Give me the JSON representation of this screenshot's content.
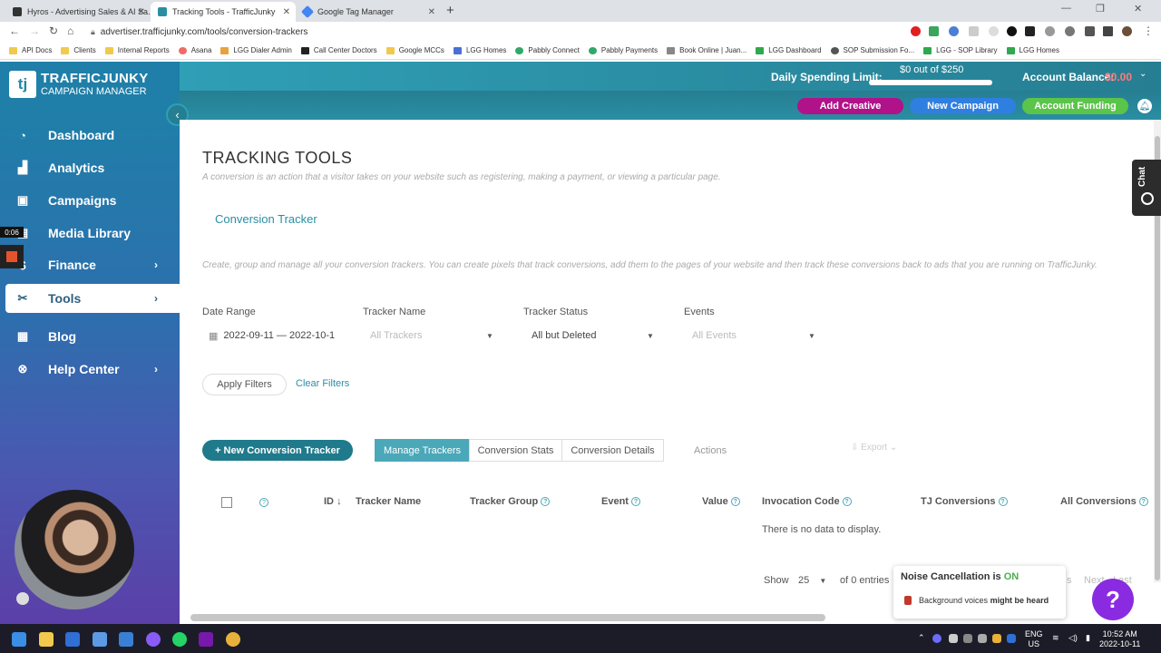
{
  "browser": {
    "tabs": [
      {
        "label": "Hyros - Advertising Sales & AI Sa...",
        "active": false
      },
      {
        "label": "Tracking Tools - TrafficJunky",
        "active": true
      },
      {
        "label": "Google Tag Manager",
        "active": false
      }
    ],
    "new_tab": "+",
    "url": "advertiser.trafficjunky.com/tools/conversion-trackers",
    "bookmarks": [
      "API Docs",
      "Clients",
      "Internal Reports",
      "Asana",
      "LGG Dialer Admin",
      "Call Center Doctors",
      "Google MCCs",
      "LGG Homes",
      "Pabbly Connect",
      "Pabbly Payments",
      "Book Online | Juan...",
      "LGG Dashboard",
      "SOP Submission Fo...",
      "LGG - SOP Library",
      "LGG Homes"
    ]
  },
  "app": {
    "logo_mark": "tj",
    "logo_line1": "TRAFFICJUNKY",
    "logo_line2": "CAMPAIGN MANAGER"
  },
  "header": {
    "spending_label": "Daily Spending Limit:",
    "spending_value": "$0 out of $250",
    "spending_progress": 0,
    "balance_label": "Account Balance:",
    "balance_value": "$0.00",
    "buttons": {
      "add_creative": "Add Creative",
      "new_campaign": "New Campaign",
      "account_funding": "Account Funding"
    },
    "colors": {
      "add_creative": "#b0128a",
      "new_campaign": "#2f7fe0",
      "account_funding": "#5bc44a"
    }
  },
  "sidebar": {
    "items": [
      {
        "label": "Dashboard",
        "icon": "dashboard-icon"
      },
      {
        "label": "Analytics",
        "icon": "analytics-icon"
      },
      {
        "label": "Campaigns",
        "icon": "campaigns-icon"
      },
      {
        "label": "Media Library",
        "icon": "media-icon"
      },
      {
        "label": "Finance",
        "icon": "finance-icon"
      },
      {
        "label": "Tools",
        "icon": "tools-icon"
      },
      {
        "label": "Blog",
        "icon": "blog-icon"
      },
      {
        "label": "Help Center",
        "icon": "help-icon"
      }
    ],
    "recording_time": "0:06"
  },
  "page": {
    "title": "TRACKING TOOLS",
    "description": "A conversion is an action that a visitor takes on your website such as registering, making a payment, or viewing a particular page.",
    "section_tab": "Conversion Tracker",
    "section_description": "Create, group and manage all your conversion trackers. You can create pixels that track conversions, add them to the pages of your website and then track these conversions back to ads that you are running on TrafficJunky."
  },
  "filters": {
    "date_range_label": "Date Range",
    "date_range_value": "2022-09-11 — 2022-10-1",
    "tracker_name_label": "Tracker Name",
    "tracker_name_placeholder": "All Trackers",
    "tracker_status_label": "Tracker Status",
    "tracker_status_value": "All but Deleted",
    "events_label": "Events",
    "events_placeholder": "All Events",
    "apply": "Apply Filters",
    "clear": "Clear Filters"
  },
  "toolbar": {
    "new_tracker": "+ New Conversion Tracker",
    "tabs": [
      "Manage Trackers",
      "Conversion Stats",
      "Conversion Details"
    ],
    "actions": "Actions",
    "export": "Export"
  },
  "table": {
    "columns": [
      "ID",
      "Tracker Name",
      "Tracker Group",
      "Event",
      "Value",
      "Invocation Code",
      "TJ Conversions",
      "All Conversions"
    ],
    "empty_message": "There is no data to display.",
    "show_label": "Show",
    "page_size": "25",
    "entries_text": "of 0 entries",
    "pagination_partial": "s",
    "next": "Next",
    "last": "Last"
  },
  "widgets": {
    "chat": "Chat",
    "help": "?",
    "noise_title": "Noise Cancellation is",
    "noise_state": "ON",
    "noise_desc_pre": "Background voices",
    "noise_desc_bold": "might be heard"
  },
  "taskbar": {
    "lang1": "ENG",
    "lang2": "US",
    "time": "10:52 AM",
    "date": "2022-10-11"
  }
}
